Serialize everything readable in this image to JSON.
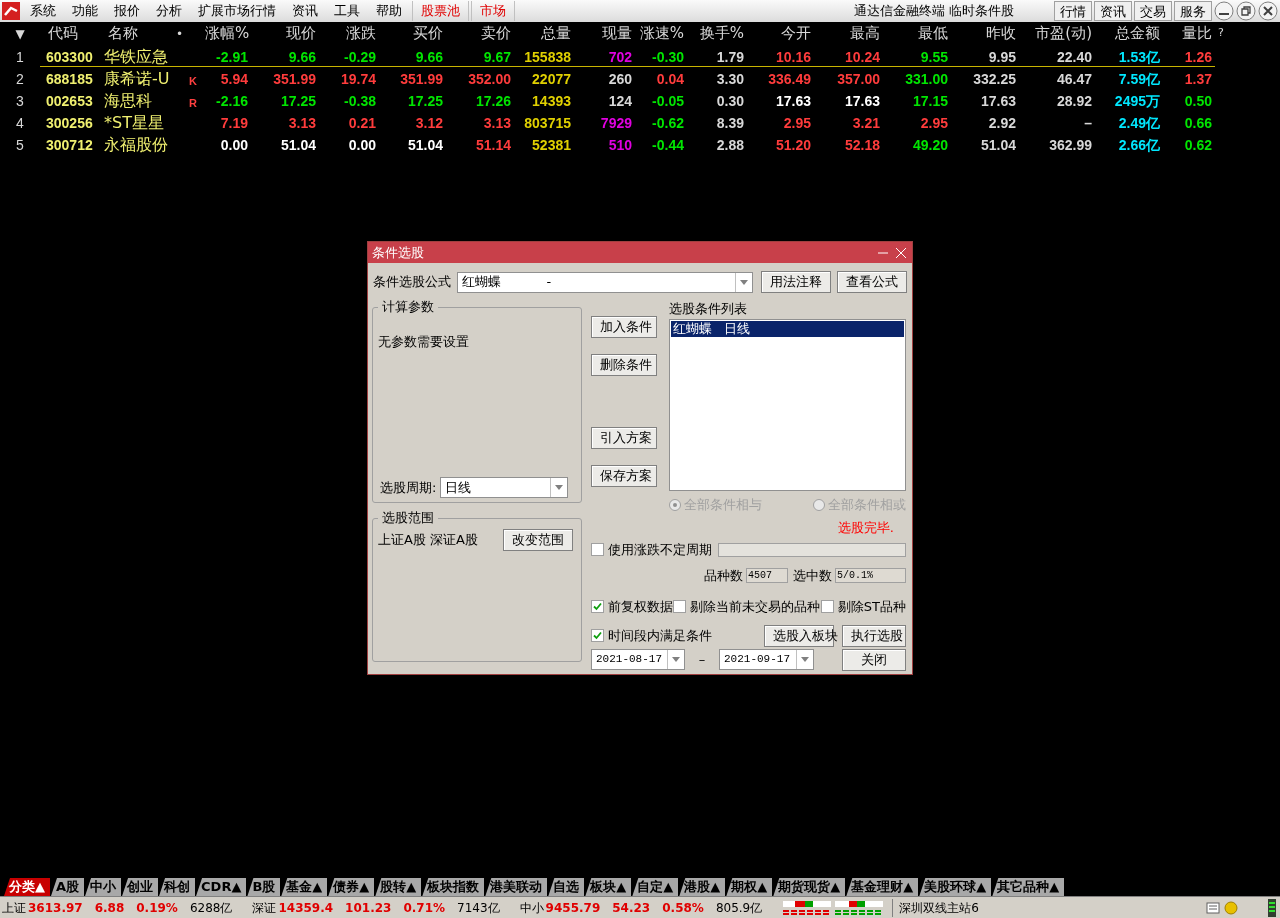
{
  "menu": {
    "items": [
      {
        "label": "系统",
        "kind": "plain"
      },
      {
        "label": "功能",
        "kind": "plain"
      },
      {
        "label": "报价",
        "kind": "plain"
      },
      {
        "label": "分析",
        "kind": "plain"
      },
      {
        "label": "扩展市场行情",
        "kind": "plain"
      },
      {
        "label": "资讯",
        "kind": "plain"
      },
      {
        "label": "工具",
        "kind": "plain"
      },
      {
        "label": "帮助",
        "kind": "plain"
      },
      {
        "label": "股票池",
        "kind": "highlight"
      },
      {
        "label": "市场",
        "kind": "highlight"
      }
    ],
    "title": "通达信金融终端 临时条件股",
    "buttons": [
      "行情",
      "资讯",
      "交易",
      "服务"
    ]
  },
  "table": {
    "columns": [
      "▼",
      "代码",
      "名称",
      "涨幅%",
      "现价",
      "涨跌",
      "买价",
      "卖价",
      "总量",
      "现量",
      "涨速%",
      "换手%",
      "今开",
      "最高",
      "最低",
      "昨收",
      "市盈(动)",
      "总金额",
      "量比"
    ],
    "header_marks": {
      "dot": "•",
      "help": "?"
    },
    "rows": [
      {
        "cells": [
          {
            "text": "1",
            "color": "#d8d8d8"
          },
          {
            "text": "603300",
            "color": "#f0f070"
          },
          {
            "text": "华铁应急",
            "color": "#f0f070"
          },
          {
            "text": "-2.91",
            "color": "#00e600"
          },
          {
            "text": "9.66",
            "color": "#00e600"
          },
          {
            "text": "-0.29",
            "color": "#00e600"
          },
          {
            "text": "9.66",
            "color": "#00e600"
          },
          {
            "text": "9.67",
            "color": "#00e600"
          },
          {
            "text": "155838",
            "color": "#e0d000"
          },
          {
            "text": "702",
            "color": "#e000e0"
          },
          {
            "text": "-0.30",
            "color": "#00e600"
          },
          {
            "text": "1.79",
            "color": "#d8d8d8"
          },
          {
            "text": "10.16",
            "color": "#ff3c3c"
          },
          {
            "text": "10.24",
            "color": "#ff3c3c"
          },
          {
            "text": "9.55",
            "color": "#00e600"
          },
          {
            "text": "9.95",
            "color": "#d8d8d8"
          },
          {
            "text": "22.40",
            "color": "#d8d8d8"
          },
          {
            "text": "1.53亿",
            "color": "#00e8ff"
          },
          {
            "text": "1.26",
            "color": "#ff3c3c"
          }
        ],
        "selected": true
      },
      {
        "flag": "K",
        "cells": [
          {
            "text": "2",
            "color": "#d8d8d8"
          },
          {
            "text": "688185",
            "color": "#f0f070"
          },
          {
            "text": "康希诺-U",
            "color": "#f0f070"
          },
          {
            "text": "5.94",
            "color": "#ff3c3c"
          },
          {
            "text": "351.99",
            "color": "#ff3c3c"
          },
          {
            "text": "19.74",
            "color": "#ff3c3c"
          },
          {
            "text": "351.99",
            "color": "#ff3c3c"
          },
          {
            "text": "352.00",
            "color": "#ff3c3c"
          },
          {
            "text": "22077",
            "color": "#e0d000"
          },
          {
            "text": "260",
            "color": "#d8d8d8"
          },
          {
            "text": "0.04",
            "color": "#ff3c3c"
          },
          {
            "text": "3.30",
            "color": "#d8d8d8"
          },
          {
            "text": "336.49",
            "color": "#ff3c3c"
          },
          {
            "text": "357.00",
            "color": "#ff3c3c"
          },
          {
            "text": "331.00",
            "color": "#00e600"
          },
          {
            "text": "332.25",
            "color": "#d8d8d8"
          },
          {
            "text": "46.47",
            "color": "#d8d8d8"
          },
          {
            "text": "7.59亿",
            "color": "#00e8ff"
          },
          {
            "text": "1.37",
            "color": "#ff3c3c"
          }
        ],
        "selected": false
      },
      {
        "flag": "R",
        "cells": [
          {
            "text": "3",
            "color": "#d8d8d8"
          },
          {
            "text": "002653",
            "color": "#f0f070"
          },
          {
            "text": "海思科",
            "color": "#f0f070"
          },
          {
            "text": "-2.16",
            "color": "#00e600"
          },
          {
            "text": "17.25",
            "color": "#00e600"
          },
          {
            "text": "-0.38",
            "color": "#00e600"
          },
          {
            "text": "17.25",
            "color": "#00e600"
          },
          {
            "text": "17.26",
            "color": "#00e600"
          },
          {
            "text": "14393",
            "color": "#e0d000"
          },
          {
            "text": "124",
            "color": "#d8d8d8"
          },
          {
            "text": "-0.05",
            "color": "#00e600"
          },
          {
            "text": "0.30",
            "color": "#d8d8d8"
          },
          {
            "text": "17.63",
            "color": "#ffffff"
          },
          {
            "text": "17.63",
            "color": "#ffffff"
          },
          {
            "text": "17.15",
            "color": "#00e600"
          },
          {
            "text": "17.63",
            "color": "#d8d8d8"
          },
          {
            "text": "28.92",
            "color": "#d8d8d8"
          },
          {
            "text": "2495万",
            "color": "#00e8ff"
          },
          {
            "text": "0.50",
            "color": "#00e600"
          }
        ],
        "selected": false
      },
      {
        "cells": [
          {
            "text": "4",
            "color": "#d8d8d8"
          },
          {
            "text": "300256",
            "color": "#f0f070"
          },
          {
            "text": "*ST星星",
            "color": "#f0f070"
          },
          {
            "text": "7.19",
            "color": "#ff3c3c"
          },
          {
            "text": "3.13",
            "color": "#ff3c3c"
          },
          {
            "text": "0.21",
            "color": "#ff3c3c"
          },
          {
            "text": "3.12",
            "color": "#ff3c3c"
          },
          {
            "text": "3.13",
            "color": "#ff3c3c"
          },
          {
            "text": "803715",
            "color": "#e0d000"
          },
          {
            "text": "7929",
            "color": "#e000e0"
          },
          {
            "text": "-0.62",
            "color": "#00e600"
          },
          {
            "text": "8.39",
            "color": "#d8d8d8"
          },
          {
            "text": "2.95",
            "color": "#ff3c3c"
          },
          {
            "text": "3.21",
            "color": "#ff3c3c"
          },
          {
            "text": "2.95",
            "color": "#ff3c3c"
          },
          {
            "text": "2.92",
            "color": "#d8d8d8"
          },
          {
            "text": "–",
            "color": "#d8d8d8"
          },
          {
            "text": "2.49亿",
            "color": "#00e8ff"
          },
          {
            "text": "0.66",
            "color": "#00e600"
          }
        ],
        "selected": false
      },
      {
        "cells": [
          {
            "text": "5",
            "color": "#d8d8d8"
          },
          {
            "text": "300712",
            "color": "#f0f070"
          },
          {
            "text": "永福股份",
            "color": "#f0f070"
          },
          {
            "text": "0.00",
            "color": "#ffffff"
          },
          {
            "text": "51.04",
            "color": "#ffffff"
          },
          {
            "text": "0.00",
            "color": "#ffffff"
          },
          {
            "text": "51.04",
            "color": "#ffffff"
          },
          {
            "text": "51.14",
            "color": "#ff3c3c"
          },
          {
            "text": "52381",
            "color": "#e0d000"
          },
          {
            "text": "510",
            "color": "#e000e0"
          },
          {
            "text": "-0.44",
            "color": "#00e600"
          },
          {
            "text": "2.88",
            "color": "#d8d8d8"
          },
          {
            "text": "51.20",
            "color": "#ff3c3c"
          },
          {
            "text": "52.18",
            "color": "#ff3c3c"
          },
          {
            "text": "49.20",
            "color": "#00e600"
          },
          {
            "text": "51.04",
            "color": "#d8d8d8"
          },
          {
            "text": "362.99",
            "color": "#d8d8d8"
          },
          {
            "text": "2.66亿",
            "color": "#00e8ff"
          },
          {
            "text": "0.62",
            "color": "#00e600"
          }
        ],
        "selected": false
      }
    ]
  },
  "dialog": {
    "title": "条件选股",
    "formula_label": "条件选股公式",
    "formula_value": "红蝴蝶           -",
    "formula_buttons": [
      "用法注释",
      "查看公式"
    ],
    "params_title": "计算参数",
    "params_text": "无参数需要设置",
    "period_label": "选股周期:",
    "period_value": "日线",
    "scope_title": "选股范围",
    "scope_text": "上证A股 深证A股",
    "scope_button": "改变范围",
    "action_buttons": [
      "加入条件",
      "删除条件",
      "引入方案",
      "保存方案"
    ],
    "list_title": "选股条件列表",
    "conditions": [
      {
        "text": "红蝴蝶   日线",
        "selected": true
      }
    ],
    "logic": [
      {
        "label": "全部条件相与",
        "selected": true,
        "disabled": true
      },
      {
        "label": "全部条件相或",
        "selected": false,
        "disabled": true
      }
    ],
    "status": "选股完毕.",
    "variable_period": {
      "label": "使用涨跌不定周期",
      "checked": false
    },
    "count_label": "品种数",
    "count_value": "4507",
    "picked_label": "选中数",
    "picked_value": "5/0.1%",
    "options": [
      {
        "label": "前复权数据",
        "checked": true
      },
      {
        "label": "剔除当前未交易的品种",
        "checked": false
      },
      {
        "label": "剔除ST品种",
        "checked": false
      }
    ],
    "time_range": {
      "label": "时间段内满足条件",
      "checked": true
    },
    "to_block_button": "选股入板块",
    "run_button": "执行选股",
    "close_button": "关闭",
    "date_from": "2021-08-17",
    "date_sep": "–",
    "date_to": "2021-09-17"
  },
  "bottom_tabs": [
    {
      "label": "分类▲",
      "selected": true
    },
    {
      "label": "A股",
      "selected": false
    },
    {
      "label": "中小",
      "selected": false
    },
    {
      "label": "创业",
      "selected": false
    },
    {
      "label": "科创",
      "selected": false
    },
    {
      "label": "CDR▲",
      "selected": false
    },
    {
      "label": "B股",
      "selected": false
    },
    {
      "label": "基金▲",
      "selected": false
    },
    {
      "label": "债券▲",
      "selected": false
    },
    {
      "label": "股转▲",
      "selected": false
    },
    {
      "label": "板块指数",
      "selected": false
    },
    {
      "label": "港美联动",
      "selected": false
    },
    {
      "label": "自选",
      "selected": false
    },
    {
      "label": "板块▲",
      "selected": false
    },
    {
      "label": "自定▲",
      "selected": false
    },
    {
      "label": "港股▲",
      "selected": false
    },
    {
      "label": "期权▲",
      "selected": false
    },
    {
      "label": "期货现货▲",
      "selected": false
    },
    {
      "label": "基金理财▲",
      "selected": false
    },
    {
      "label": "美股环球▲",
      "selected": false
    },
    {
      "label": "其它品种▲",
      "selected": false
    }
  ],
  "status_bar": {
    "indices": [
      {
        "name": "上证",
        "price": "3613.97",
        "change": "6.88",
        "pct": "0.19%",
        "amount": "6288亿"
      },
      {
        "name": "深证",
        "price": "14359.4",
        "change": "101.23",
        "pct": "0.71%",
        "amount": "7143亿"
      },
      {
        "name": "中小",
        "price": "9455.79",
        "change": "54.23",
        "pct": "0.58%",
        "amount": "805.9亿"
      }
    ],
    "server": "深圳双线主站6"
  }
}
